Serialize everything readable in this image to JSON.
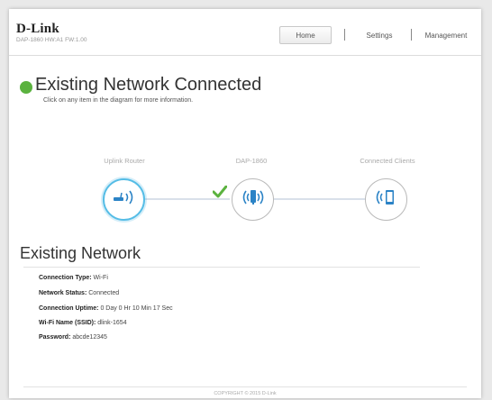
{
  "header": {
    "logo": "D-Link",
    "model": "DAP-1860   HW:A1   FW:1.00",
    "nav": [
      "Home",
      "Settings",
      "Management"
    ]
  },
  "status": {
    "title": "Existing Network Connected",
    "subtitle": "Click on any item in the diagram for more information.",
    "color": "#5bb23f"
  },
  "diagram": {
    "labels": [
      "Uplink Router",
      "DAP-1860",
      "Connected Clients"
    ],
    "icons": [
      "router-icon",
      "extender-icon",
      "client-device-icon"
    ],
    "check_icon": "checkmark-icon",
    "active_color": "#56bde6"
  },
  "existing_network": {
    "title": "Existing Network",
    "rows": [
      {
        "label": "Connection Type:",
        "value": "Wi-Fi"
      },
      {
        "label": "Network Status:",
        "value": "Connected"
      },
      {
        "label": "Connection Uptime:",
        "value": "0 Day 0 Hr 10 Min 17 Sec"
      },
      {
        "label": "Wi-Fi Name (SSID):",
        "value": "dlink-1654"
      },
      {
        "label": "Password:",
        "value": "abcde12345"
      }
    ]
  },
  "footer": {
    "copyright": "COPYRIGHT © 2015 D-Link"
  }
}
